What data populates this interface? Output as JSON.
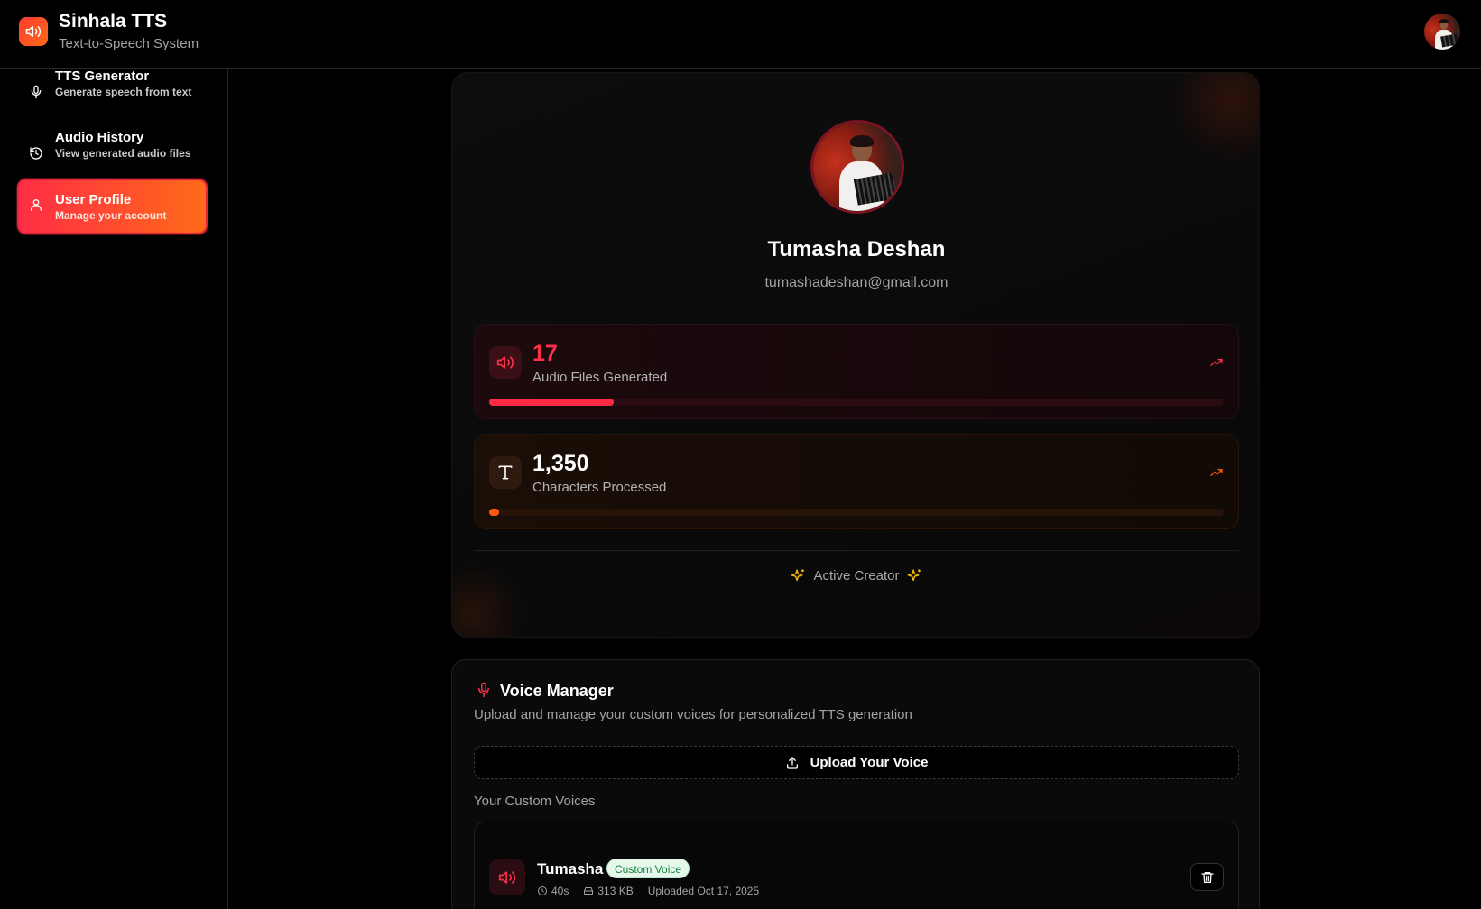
{
  "app": {
    "title": "Sinhala TTS",
    "subtitle": "Text-to-Speech System",
    "brand_color": "#ff4d2a"
  },
  "sidebar": {
    "items": [
      {
        "label": "TTS Generator",
        "sub": "Generate speech from text",
        "icon": "mic-icon",
        "active": false
      },
      {
        "label": "Audio History",
        "sub": "View generated audio files",
        "icon": "history-icon",
        "active": false
      },
      {
        "label": "User Profile",
        "sub": "Manage your account",
        "icon": "user-icon",
        "active": true
      }
    ]
  },
  "profile": {
    "name": "Tumasha Deshan",
    "email": "tumashadeshan@gmail.com",
    "stats": [
      {
        "value": "17",
        "label": "Audio Files Generated",
        "progress": 0.17,
        "color": "#ff2a45",
        "icon": "speaker-icon"
      },
      {
        "value": "1,350",
        "label": "Characters Processed",
        "progress": 0.013,
        "color": "#ff5a10",
        "icon": "type-icon"
      }
    ],
    "badge": "Active Creator"
  },
  "voice_manager": {
    "title": "Voice Manager",
    "description": "Upload and manage your custom voices for personalized TTS generation",
    "upload_label": "Upload Your Voice",
    "custom_title": "Your Custom Voices",
    "voices": [
      {
        "name": "Tumasha",
        "badge": "Custom Voice",
        "duration": "40s",
        "size": "313 KB",
        "uploaded": "Uploaded Oct 17, 2025"
      }
    ]
  }
}
